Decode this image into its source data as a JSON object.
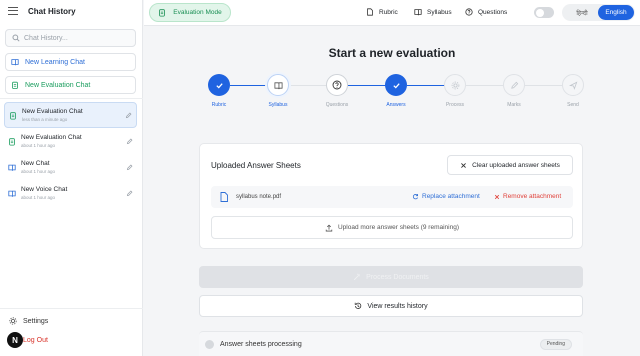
{
  "sidebar": {
    "title": "Chat History",
    "search_placeholder": "Chat History...",
    "new_learning_chat": "New Learning Chat",
    "new_evaluation_chat": "New Evaluation Chat",
    "chats": [
      {
        "title": "New Evaluation Chat",
        "subtitle": "less than a minute ago",
        "active": true,
        "icon": "clipboard-icon"
      },
      {
        "title": "New Evaluation Chat",
        "subtitle": "about 1 hour ago",
        "active": false,
        "icon": "clipboard-icon"
      },
      {
        "title": "New Chat",
        "subtitle": "about 1 hour ago",
        "active": false,
        "icon": "book-icon"
      },
      {
        "title": "New Voice Chat",
        "subtitle": "about 1 hour ago",
        "active": false,
        "icon": "book-icon"
      }
    ],
    "settings_label": "Settings",
    "logout_label": "Log Out",
    "badge_letter": "N"
  },
  "topbar": {
    "mode_label": "Evaluation Mode",
    "rubric_label": "Rubric",
    "syllabus_label": "Syllabus",
    "questions_label": "Questions",
    "lang_other": "हिन्दी",
    "lang_selected": "English"
  },
  "main": {
    "title": "Start a new evaluation",
    "steps": [
      {
        "label": "Rubric",
        "state": "done"
      },
      {
        "label": "Syllabus",
        "state": "current"
      },
      {
        "label": "Questions",
        "state": "todo"
      },
      {
        "label": "Answers",
        "state": "done"
      },
      {
        "label": "Process",
        "state": "todo"
      },
      {
        "label": "Marks",
        "state": "todo"
      },
      {
        "label": "Send",
        "state": "todo"
      }
    ],
    "card_title": "Uploaded Answer Sheets",
    "clear_button": "Clear uploaded answer sheets",
    "file_name": "syllabus note.pdf",
    "replace_label": "Replace attachment",
    "remove_label": "Remove attachment",
    "upload_more_label": "Upload more answer sheets (9 remaining)",
    "process_button": "Process Documents",
    "history_button": "View results history",
    "processing_label": "Answer sheets processing",
    "pending_badge": "Pending"
  },
  "colors": {
    "accent": "#1f63e0",
    "green": "#1a8f54",
    "danger": "#e0413a"
  }
}
